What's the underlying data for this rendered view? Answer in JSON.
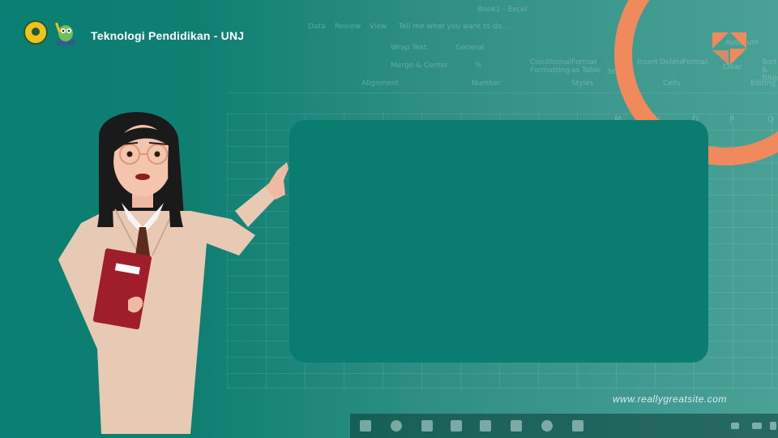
{
  "brand": {
    "title": "Teknologi Pendidikan - UNJ"
  },
  "footer": {
    "website": "www.reallygreatsite.com"
  },
  "background_excel": {
    "window_title": "Book1 - Excel",
    "menu": [
      "Data",
      "Review",
      "View",
      "Tell me what you want to do..."
    ],
    "ribbon": {
      "wrap_text": "Wrap Text",
      "number_format": "General",
      "merge_center": "Merge & Center",
      "percent": "%",
      "conditional_formatting": "Conditional Formatting",
      "format_as_table": "Format as Table",
      "styles_short": "St",
      "insert": "Insert",
      "delete": "Delete",
      "format": "Format",
      "autosum": "AutoSum",
      "clear": "Clear",
      "sort_filter": "Sort & Filter",
      "groups": [
        "Alignment",
        "Number",
        "Styles",
        "Cells",
        "Editing"
      ]
    },
    "columns": [
      "M",
      "N",
      "O",
      "P",
      "Q"
    ]
  },
  "colors": {
    "accent_ring": "#f08a5d",
    "board": "#0b7d70",
    "background": "#0f7f72",
    "jacket": "#e8c9b4",
    "book": "#a01d2c"
  },
  "icons": [
    "unj-logo-icon",
    "mascot-logo-icon",
    "triangle-pattern-icon"
  ]
}
